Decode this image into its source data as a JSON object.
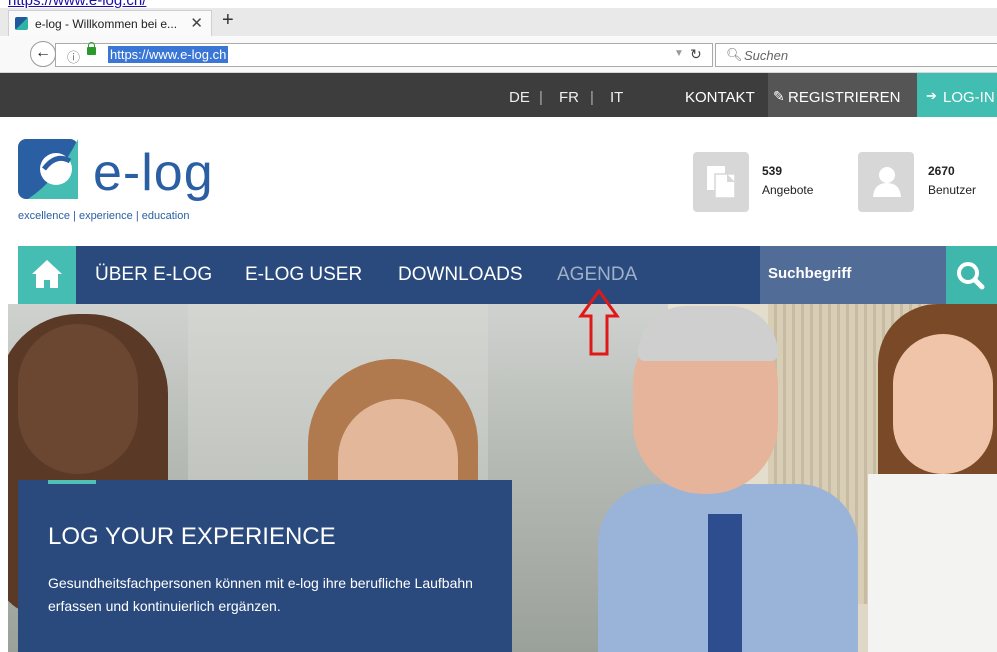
{
  "browser": {
    "top_link": "https://www.e-log.ch/",
    "tab_title": "e-log - Willkommen bei e...",
    "url": "https://www.e-log.ch",
    "search_placeholder": "Suchen"
  },
  "topbar": {
    "languages": [
      "DE",
      "FR",
      "IT"
    ],
    "separator": "|",
    "contact": "KONTAKT",
    "register": "REGISTRIEREN",
    "login": "LOG-IN"
  },
  "brand": {
    "logo_text": "e-log",
    "tagline": "excellence | experience | education"
  },
  "stats": [
    {
      "value": "539",
      "label": "Angebote",
      "icon": "document-icon"
    },
    {
      "value": "2670",
      "label": "Benutzer",
      "icon": "user-icon"
    }
  ],
  "nav": {
    "items": [
      "ÜBER E-LOG",
      "E-LOG USER",
      "DOWNLOADS",
      "AGENDA"
    ],
    "search_placeholder": "Suchbegriff"
  },
  "hero": {
    "heading": "LOG YOUR EXPERIENCE",
    "text": "Gesundheitsfachpersonen können mit e-log ihre berufliche Laufbahn erfassen und kontinuierlich ergänzen."
  },
  "colors": {
    "brand_blue": "#2a4a7e",
    "teal": "#41bdb2",
    "dark_bar": "#3d3d3d",
    "annotation_red": "#e01818"
  }
}
